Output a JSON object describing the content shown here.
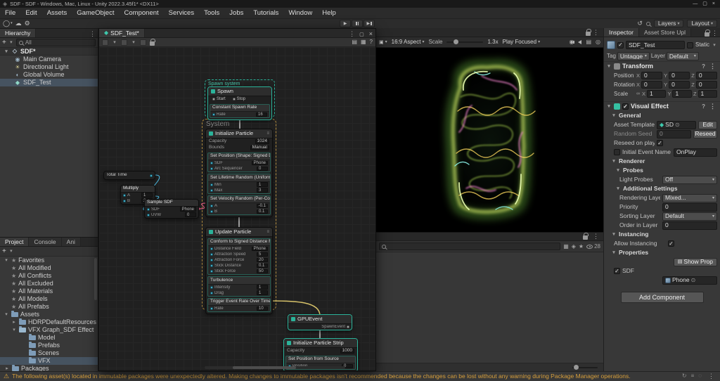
{
  "title_bar": {
    "title": "SDF - SDF - Windows, Mac, Linux - Unity 2022.3.45f1* <DX11>"
  },
  "menu_bar": {
    "items": [
      "File",
      "Edit",
      "Assets",
      "GameObject",
      "Component",
      "Services",
      "Tools",
      "Jobs",
      "Tutorials",
      "Window",
      "Help"
    ]
  },
  "toolbar": {
    "layers": "Layers",
    "layout": "Layout"
  },
  "hierarchy": {
    "tab": "Hierarchy",
    "search_filter": "All",
    "scene": "SDF*",
    "items": [
      {
        "label": "Main Camera",
        "icon": "camera-icon"
      },
      {
        "label": "Directional Light",
        "icon": "light-icon"
      },
      {
        "label": "Global Volume",
        "icon": "volume-icon"
      },
      {
        "label": "SDF_Test",
        "icon": "vfx-object-icon",
        "selected": true
      }
    ]
  },
  "vfx": {
    "tab": "SDF_Test*",
    "spawn_system_label": "Spawn system",
    "system_label": "System",
    "nodes": {
      "spawn": {
        "title": "Spawn",
        "ports": [
          "Start",
          "Stop"
        ],
        "blocks": [
          {
            "title": "Constant Spawn Rate",
            "rows": [
              {
                "label": "Rate",
                "value": "16"
              }
            ]
          }
        ]
      },
      "initialize": {
        "title": "Initialize Particle",
        "settings": [
          {
            "label": "Capacity",
            "value": "1024"
          },
          {
            "label": "Bounds",
            "value": "Manual"
          }
        ],
        "blocks": [
          {
            "title": "Set Position (Shape: Signed Distance Field)",
            "rows": [
              {
                "label": "SDF",
                "value": "Phone"
              },
              {
                "label": "Arc Sequencer",
                "value": "0"
              }
            ]
          },
          {
            "title": "Set Lifetime Random (Uniform)",
            "rows": [
              {
                "label": "Min",
                "value": "1"
              },
              {
                "label": "Max",
                "value": "3"
              }
            ]
          },
          {
            "title": "Set Velocity Random (Per-Component)",
            "rows": [
              {
                "label": "A",
                "value": "-0.1"
              },
              {
                "label": "B",
                "value": "0.1"
              }
            ]
          }
        ]
      },
      "update": {
        "title": "Update Particle",
        "blocks": [
          {
            "title": "Conform to Signed Distance Field",
            "rows": [
              {
                "label": "Distance Field",
                "value": "Phone"
              },
              {
                "label": "Attraction Speed",
                "value": "5"
              },
              {
                "label": "Attraction Force",
                "value": "20"
              },
              {
                "label": "Stick Distance",
                "value": "0.1"
              },
              {
                "label": "Stick Force",
                "value": "50"
              }
            ]
          },
          {
            "title": "Turbulence",
            "rows": [
              {
                "label": "Intensity",
                "value": "1"
              },
              {
                "label": "Drag",
                "value": "1"
              }
            ]
          },
          {
            "title": "Trigger Event Rate Over Time",
            "rows": [
              {
                "label": "Rate",
                "value": "10"
              }
            ]
          }
        ]
      },
      "gpuevent": {
        "title": "GPUEvent",
        "out": "SpawnEvent"
      },
      "strip": {
        "title": "Initialize Particle Strip",
        "settings": [
          {
            "label": "Capacity",
            "value": "1000"
          }
        ],
        "blocks": [
          {
            "title": "Set Position from Source",
            "rows": [
              {
                "label": "Position",
                "value": "0"
              }
            ]
          }
        ]
      },
      "op_time": {
        "title": "Total Time"
      },
      "op_multiply": {
        "title": "Multiply",
        "rows": [
          {
            "label": "A",
            "value": "1"
          },
          {
            "label": "B",
            "value": "2"
          }
        ]
      },
      "op_sample": {
        "title": "Sample SDF",
        "rows": [
          {
            "label": "SDF",
            "value": "Phone"
          },
          {
            "label": "UVW",
            "value": "0"
          }
        ]
      }
    }
  },
  "game": {
    "aspect": "16:9 Aspect",
    "scale_label": "Scale",
    "scale_value": "1.3x",
    "focus_mode": "Play Focused"
  },
  "project": {
    "tabs": [
      {
        "label": "Project",
        "active": true
      },
      {
        "label": "Console"
      },
      {
        "label": "Ani"
      }
    ],
    "favorites_label": "Favorites",
    "favorites": [
      "All Modified",
      "All Conflicts",
      "All Excluded",
      "All Materials",
      "All Models",
      "All Prefabs"
    ],
    "assets_label": "Assets",
    "assets": [
      {
        "label": "HDRPDefaultResources",
        "indent": 1,
        "caret": "▸"
      },
      {
        "label": "VFX Graph_SDF Effect",
        "indent": 1,
        "caret": "▾",
        "open": true
      },
      {
        "label": "Model",
        "indent": 2
      },
      {
        "label": "Prefabs",
        "indent": 2
      },
      {
        "label": "Scenes",
        "indent": 2
      },
      {
        "label": "VFX",
        "indent": 2,
        "selected": true
      },
      {
        "label": "Packages",
        "indent": 0,
        "caret": "▸"
      }
    ],
    "hidden_count": "28"
  },
  "inspector": {
    "tabs": [
      {
        "label": "Inspector",
        "active": true
      },
      {
        "label": "Asset Store Upl"
      }
    ],
    "gameobject": {
      "name": "SDF_Test",
      "static_label": "Static",
      "tag_label": "Tag",
      "tag_value": "Untagged",
      "layer_label": "Layer",
      "layer_value": "Default"
    },
    "transform": {
      "title": "Transform",
      "rows": [
        {
          "label": "Position",
          "coords": [
            {
              "a": "X",
              "v": "0"
            },
            {
              "a": "Y",
              "v": "0"
            },
            {
              "a": "Z",
              "v": "0"
            }
          ]
        },
        {
          "label": "Rotation",
          "coords": [
            {
              "a": "X",
              "v": "0"
            },
            {
              "a": "Y",
              "v": "0"
            },
            {
              "a": "Z",
              "v": "0"
            }
          ]
        },
        {
          "label": "Scale",
          "link": true,
          "coords": [
            {
              "a": "X",
              "v": "1"
            },
            {
              "a": "Y",
              "v": "1"
            },
            {
              "a": "Z",
              "v": "1"
            }
          ]
        }
      ]
    },
    "visual_effect": {
      "title": "Visual Effect",
      "general_label": "General",
      "asset_template": {
        "label": "Asset Template",
        "value": "SD",
        "button": "Edit"
      },
      "random_seed": {
        "label": "Random Seed",
        "value": "0",
        "button": "Reseed"
      },
      "reseed_on_play": {
        "label": "Reseed on play"
      },
      "initial_event": {
        "label": "Initial Event Name",
        "value": "OnPlay"
      },
      "renderer_label": "Renderer",
      "probes_label": "Probes",
      "light_probes": {
        "label": "Light Probes",
        "value": "Off"
      },
      "additional_label": "Additional Settings",
      "additional_rows": [
        {
          "label": "Rendering Layer",
          "value": "Mixed...",
          "dropdown": true
        },
        {
          "label": "Priority",
          "value": "0"
        },
        {
          "label": "Sorting Layer",
          "value": "Default",
          "dropdown": true
        },
        {
          "label": "Order in Layer",
          "value": "0"
        }
      ],
      "instancing_label": "Instancing",
      "allow_instancing": "Allow Instancing",
      "properties_label": "Properties",
      "show_properties": "Show Prop",
      "sdf_property": {
        "label": "SDF",
        "value": "Phone"
      }
    },
    "add_component": "Add Component"
  },
  "status_bar": {
    "message": "The following asset(s) located in immutable packages were unexpectedly altered. Making changes to immutable packages isn't recommended because the changes can be lost without any warning during Package Manager operations."
  }
}
